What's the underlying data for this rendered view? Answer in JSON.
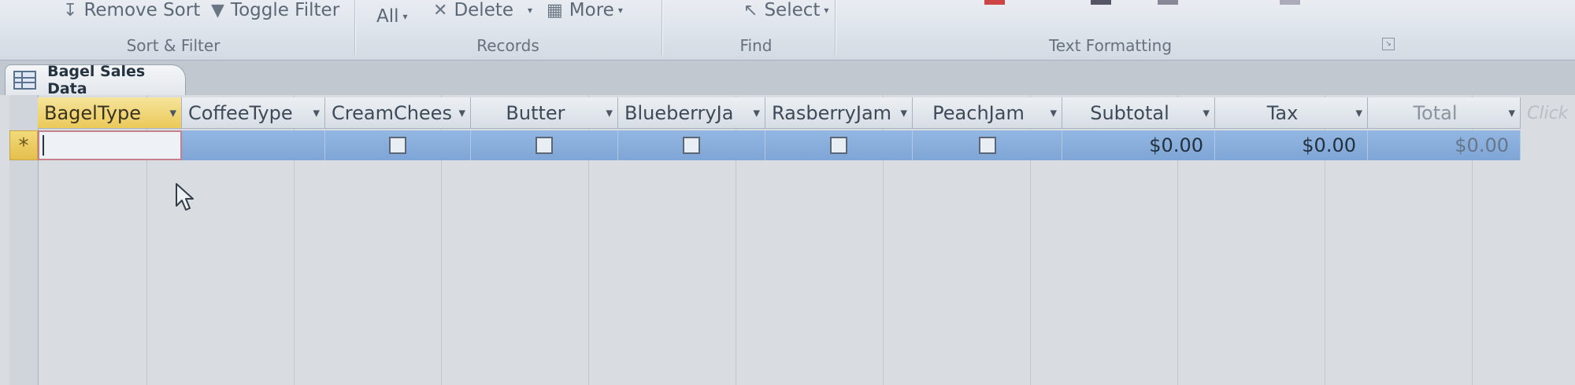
{
  "ribbon": {
    "sort_filter": {
      "remove_sort_label": "Remove Sort",
      "toggle_filter_label": "Toggle Filter",
      "group_label": "Sort & Filter"
    },
    "records": {
      "all_label": "All",
      "delete_label": "Delete",
      "more_label": "More",
      "group_label": "Records"
    },
    "find": {
      "select_label": "Select",
      "group_label": "Find"
    },
    "text_formatting": {
      "group_label": "Text Formatting"
    }
  },
  "document_tab": {
    "label": "Bagel Sales Data"
  },
  "datasheet": {
    "columns": [
      "BagelType",
      "CoffeeType",
      "CreamChees",
      "Butter",
      "BlueberryJa",
      "RasberryJam",
      "PeachJam",
      "Subtotal",
      "Tax",
      "Total"
    ],
    "add_field_label": "Click",
    "new_record_marker": "*",
    "new_record": {
      "subtotal": "$0.00",
      "tax": "$0.00",
      "total": "$0.00"
    }
  },
  "colors": {
    "active_header": "#ebc95a",
    "row_highlight": "#7ea5d6",
    "focus_border": "#c7818b"
  }
}
